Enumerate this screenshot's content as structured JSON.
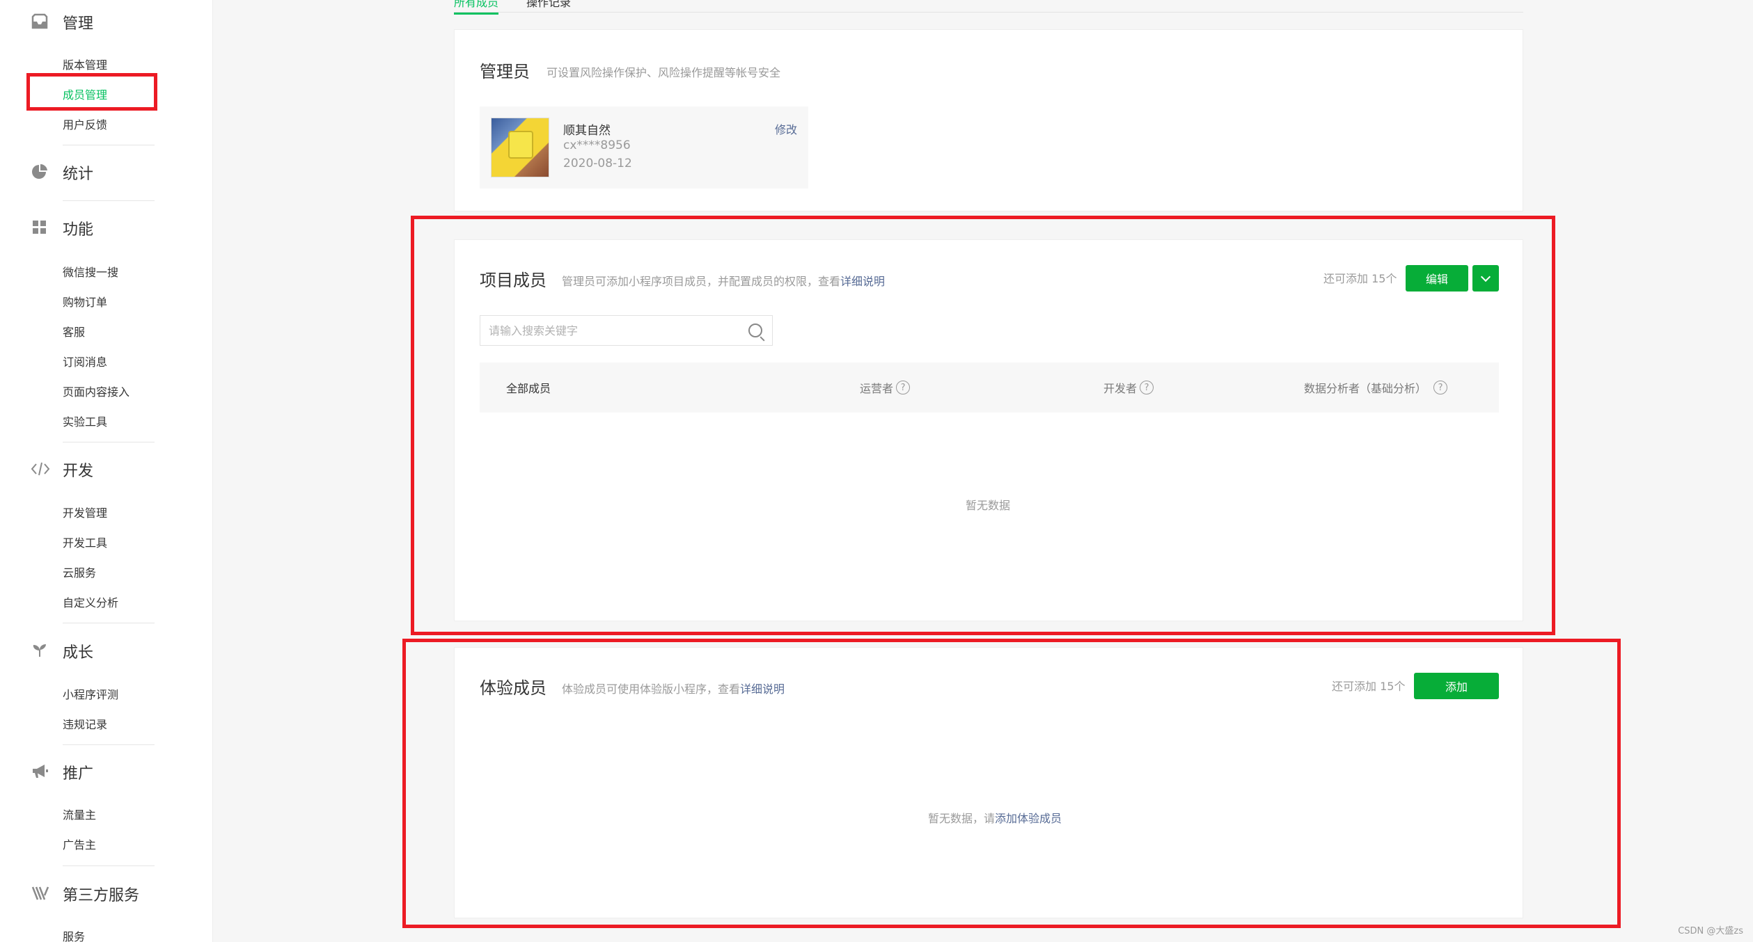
{
  "sidebar": {
    "groups": [
      {
        "title": "管理",
        "icon": "inbox-icon",
        "items": [
          "版本管理",
          "成员管理",
          "用户反馈"
        ]
      },
      {
        "title": "统计",
        "icon": "pie-chart-icon",
        "items": []
      },
      {
        "title": "功能",
        "icon": "grid-icon",
        "items": [
          "微信搜一搜",
          "购物订单",
          "客服",
          "订阅消息",
          "页面内容接入",
          "实验工具"
        ]
      },
      {
        "title": "开发",
        "icon": "code-icon",
        "items": [
          "开发管理",
          "开发工具",
          "云服务",
          "自定义分析"
        ]
      },
      {
        "title": "成长",
        "icon": "sprout-icon",
        "items": [
          "小程序评测",
          "违规记录"
        ]
      },
      {
        "title": "推广",
        "icon": "megaphone-icon",
        "items": [
          "流量主",
          "广告主"
        ]
      },
      {
        "title": "第三方服务",
        "icon": "third-party-icon",
        "items": [
          "服务"
        ]
      }
    ],
    "active_item": "成员管理"
  },
  "tabs": [
    "所有成员",
    "操作记录"
  ],
  "admin_card": {
    "title": "管理员",
    "desc": "可设置风险操作保护、风险操作提醒等帐号安全",
    "admin": {
      "name": "顺其自然",
      "id": "cx****8956",
      "date": "2020-08-12",
      "edit_label": "修改"
    }
  },
  "project_card": {
    "title": "项目成员",
    "desc": "管理员可添加小程序项目成员，并配置成员的权限，查看",
    "desc_link": "详细说明",
    "quota": "还可添加 15个",
    "edit_button": "编辑",
    "search_placeholder": "请输入搜索关键字",
    "columns": [
      "全部成员",
      "运营者",
      "开发者",
      "数据分析者（基础分析）"
    ],
    "empty_text": "暂无数据"
  },
  "experience_card": {
    "title": "体验成员",
    "desc": "体验成员可使用体验版小程序，查看",
    "desc_link": "详细说明",
    "quota": "还可添加 15个",
    "add_button": "添加",
    "empty_text": "暂无数据，请",
    "empty_link": "添加体验成员"
  },
  "watermark": "CSDN @大盛zs",
  "colors": {
    "accent": "#07c160",
    "button": "#07ad38",
    "link": "#576b95",
    "highlight": "#ec1b24"
  }
}
